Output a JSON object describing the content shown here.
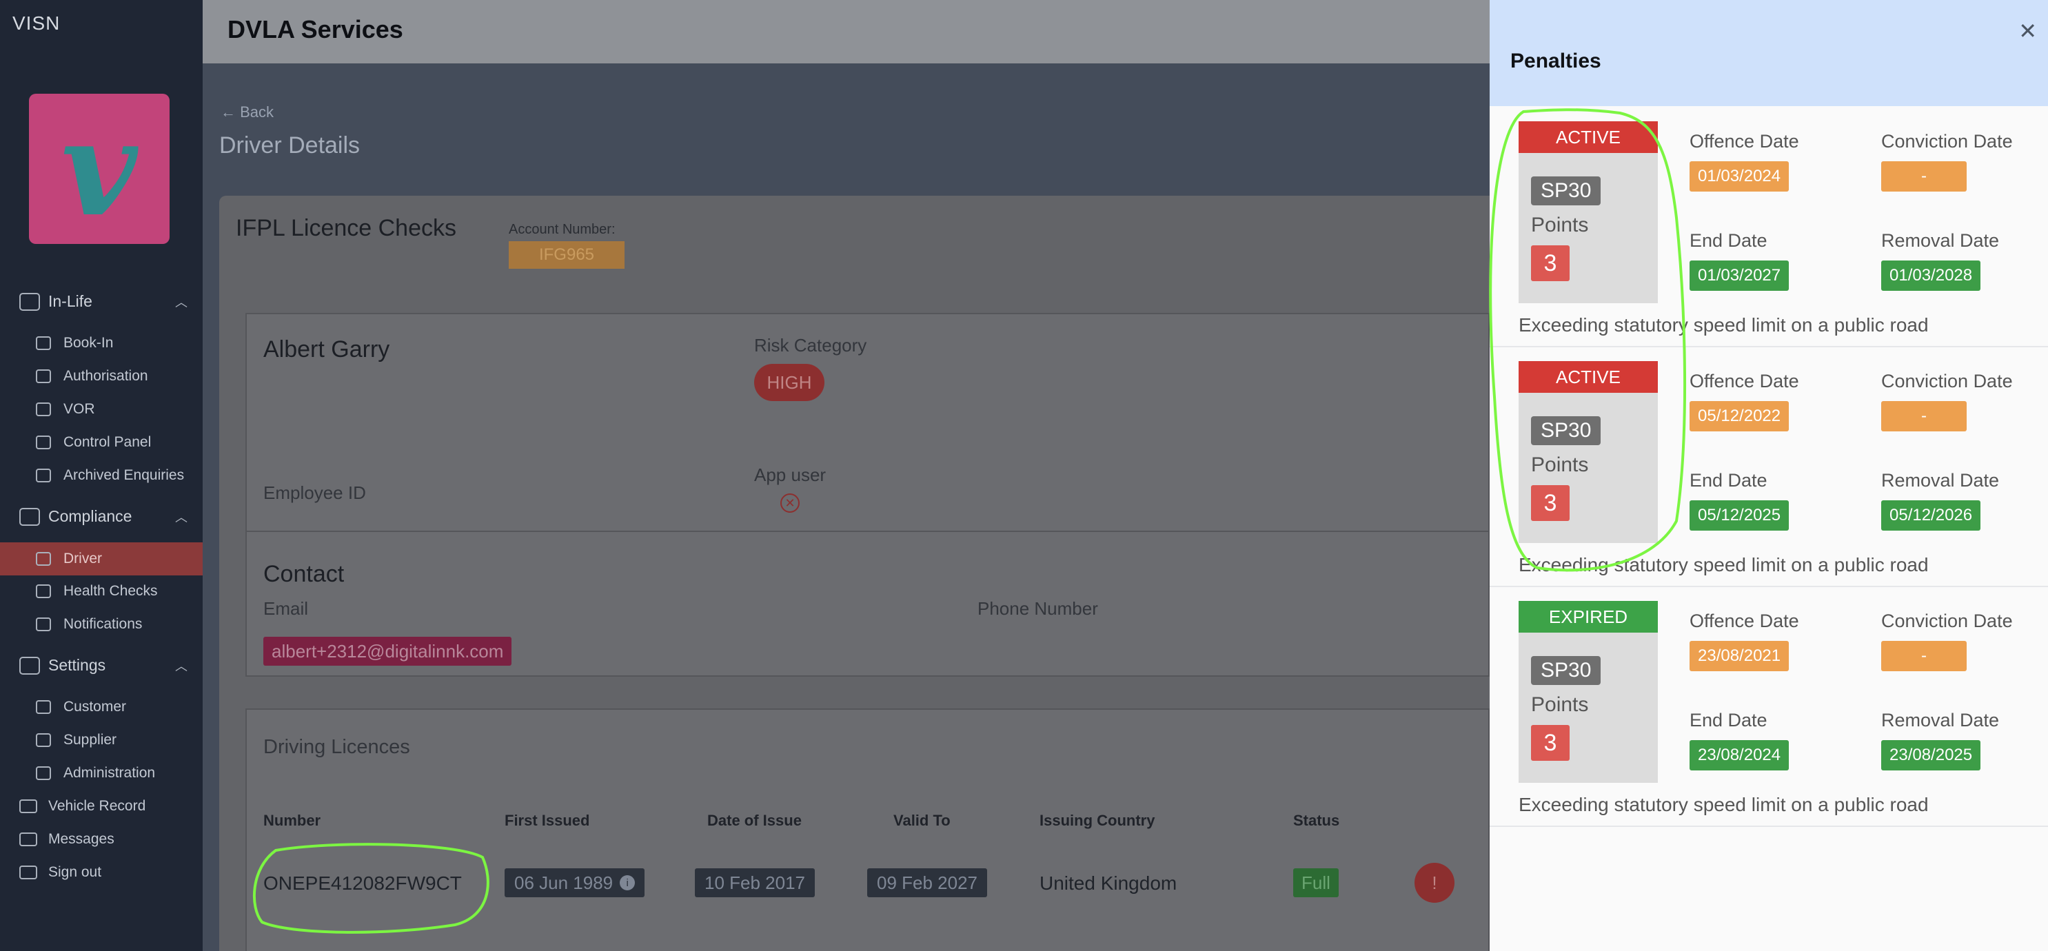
{
  "brand": "VISN",
  "sidebar": {
    "groups": [
      {
        "label": "In-Life",
        "items": [
          "Book-In",
          "Authorisation",
          "VOR",
          "Control Panel",
          "Archived Enquiries"
        ]
      },
      {
        "label": "Compliance",
        "items": [
          "Driver",
          "Health Checks",
          "Notifications"
        ]
      },
      {
        "label": "Settings",
        "items": [
          "Customer",
          "Supplier",
          "Administration"
        ]
      }
    ],
    "top_items": [
      "Vehicle Record",
      "Messages",
      "Sign out"
    ]
  },
  "header": {
    "title": "DVLA Services"
  },
  "page": {
    "back": "← Back",
    "title": "Driver Details"
  },
  "card": {
    "title": "IFPL Licence Checks",
    "account_label": "Account Number:",
    "account_value": "IFG965"
  },
  "driver": {
    "name": "Albert Garry",
    "risk_label": "Risk Category",
    "risk_value": "HIGH",
    "employee_label": "Employee ID",
    "app_user_label": "App user"
  },
  "contact": {
    "title": "Contact",
    "email_label": "Email",
    "email_value": "albert+2312@digitalinnk.com",
    "phone_label": "Phone Number"
  },
  "licences": {
    "title": "Driving Licences",
    "columns": [
      "Number",
      "First Issued",
      "Date of Issue",
      "Valid To",
      "Issuing Country",
      "Status"
    ],
    "row": {
      "number": "ONEPE412082FW9CT",
      "first_issued": "06 Jun 1989",
      "date_of_issue": "10 Feb 2017",
      "valid_to": "09 Feb 2027",
      "country": "United Kingdom",
      "status": "Full"
    }
  },
  "drawer": {
    "title": "Penalties",
    "labels": {
      "offence": "Offence Date",
      "conviction": "Conviction Date",
      "end": "End Date",
      "removal": "Removal Date",
      "points": "Points"
    },
    "penalties": [
      {
        "status": "ACTIVE",
        "code": "SP30",
        "points": "3",
        "offence_date": "01/03/2024",
        "conviction_date": "-",
        "end_date": "01/03/2027",
        "removal_date": "01/03/2028",
        "description": "Exceeding statutory speed limit on a public road"
      },
      {
        "status": "ACTIVE",
        "code": "SP30",
        "points": "3",
        "offence_date": "05/12/2022",
        "conviction_date": "-",
        "end_date": "05/12/2025",
        "removal_date": "05/12/2026",
        "description": "Exceeding statutory speed limit on a public road"
      },
      {
        "status": "EXPIRED",
        "code": "SP30",
        "points": "3",
        "offence_date": "23/08/2021",
        "conviction_date": "-",
        "end_date": "23/08/2024",
        "removal_date": "23/08/2025",
        "description": "Exceeding statutory speed limit on a public road"
      }
    ]
  }
}
